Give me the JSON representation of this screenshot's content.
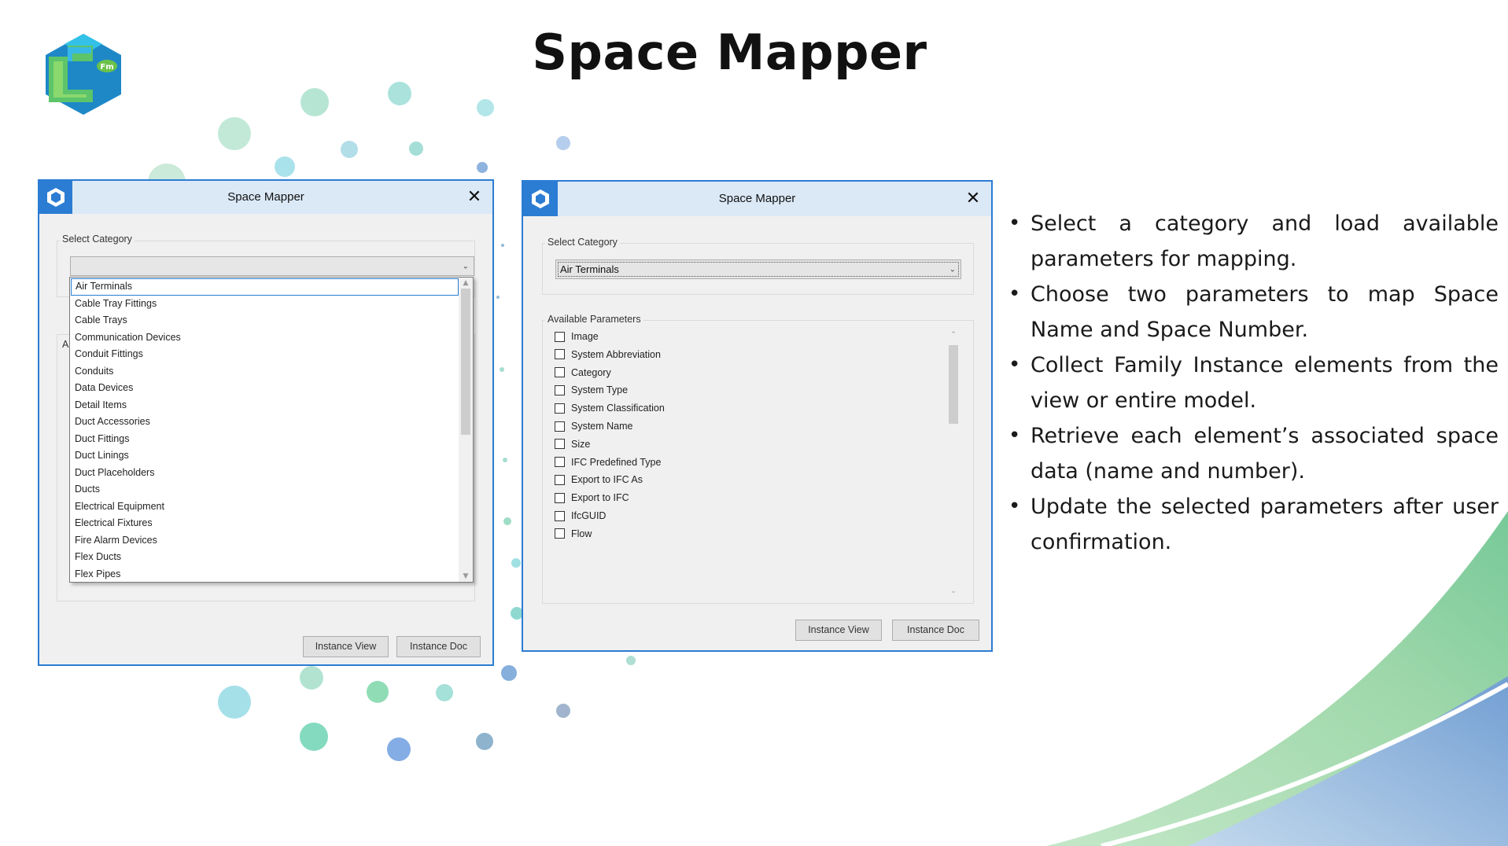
{
  "slide": {
    "title": "Space Mapper",
    "logo_text": "Fm"
  },
  "left_window": {
    "title": "Space Mapper",
    "close_glyph": "✕",
    "select_category_label": "Select Category",
    "combo_value": "",
    "hidden_group_label_fragment": "A",
    "dropdown_items": [
      "Air Terminals",
      "Cable Tray Fittings",
      "Cable Trays",
      "Communication Devices",
      "Conduit Fittings",
      "Conduits",
      "Data Devices",
      "Detail Items",
      "Duct Accessories",
      "Duct Fittings",
      "Duct Linings",
      "Duct Placeholders",
      "Ducts",
      "Electrical Equipment",
      "Electrical Fixtures",
      "Fire Alarm Devices",
      "Flex Ducts",
      "Flex Pipes"
    ],
    "selected_item": "Air Terminals",
    "buttons": {
      "instance_view": "Instance View",
      "instance_doc": "Instance Doc"
    }
  },
  "right_window": {
    "title": "Space Mapper",
    "close_glyph": "✕",
    "select_category_label": "Select Category",
    "combo_value": "Air Terminals",
    "available_parameters_label": "Available Parameters",
    "parameters": [
      {
        "label": "Image",
        "checked": false
      },
      {
        "label": "System Abbreviation",
        "checked": false
      },
      {
        "label": "Category",
        "checked": false
      },
      {
        "label": "System Type",
        "checked": false
      },
      {
        "label": "System Classification",
        "checked": false
      },
      {
        "label": "System Name",
        "checked": false
      },
      {
        "label": "Size",
        "checked": false
      },
      {
        "label": "IFC Predefined Type",
        "checked": false
      },
      {
        "label": "Export to IFC As",
        "checked": false
      },
      {
        "label": "Export to IFC",
        "checked": false
      },
      {
        "label": "IfcGUID",
        "checked": false
      },
      {
        "label": "Flow",
        "checked": false
      }
    ],
    "buttons": {
      "instance_view": "Instance View",
      "instance_doc": "Instance Doc"
    }
  },
  "bullets": [
    "Select a category and load available parameters for mapping.",
    "Choose two parameters to map Space Name and Space Number.",
    "Collect Family Instance elements from the view or entire model.",
    "Retrieve each element’s associated space data (name and number).",
    "Update the selected parameters after user confirmation."
  ],
  "colors": {
    "accent_blue": "#2b7cd3",
    "titlebar": "#dbe9f7",
    "logo_blue": "#1e88c7",
    "logo_green": "#5cc46a",
    "swoosh_green": "#9fd8a8",
    "swoosh_blue": "#7fa7df"
  },
  "icons": {
    "app_icon": "hex-logo-icon",
    "close": "close-icon",
    "dropdown": "chevron-down-icon"
  }
}
